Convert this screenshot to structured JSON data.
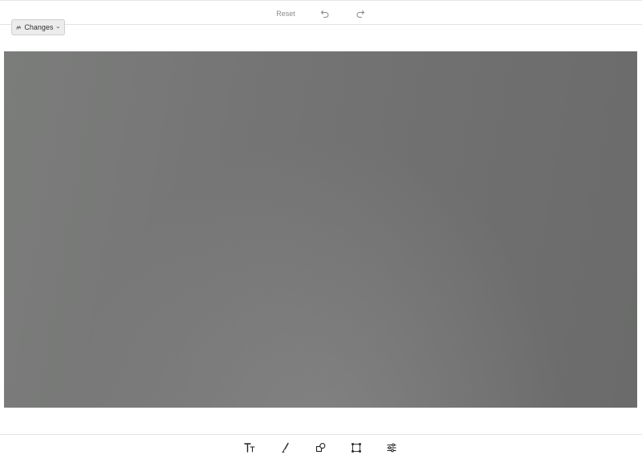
{
  "toolbar": {
    "reset_label": "Reset",
    "undo_icon": "undo-icon",
    "redo_icon": "redo-icon"
  },
  "changes": {
    "label": "Changes",
    "icon": "compare-icon"
  },
  "canvas": {
    "base_color": "#757575"
  },
  "tools": [
    {
      "name": "text-tool",
      "icon": "text-icon"
    },
    {
      "name": "draw-tool",
      "icon": "brush-icon"
    },
    {
      "name": "shapes-tool",
      "icon": "shapes-icon"
    },
    {
      "name": "crop-tool",
      "icon": "crop-icon"
    },
    {
      "name": "adjust-tool",
      "icon": "sliders-icon"
    }
  ]
}
